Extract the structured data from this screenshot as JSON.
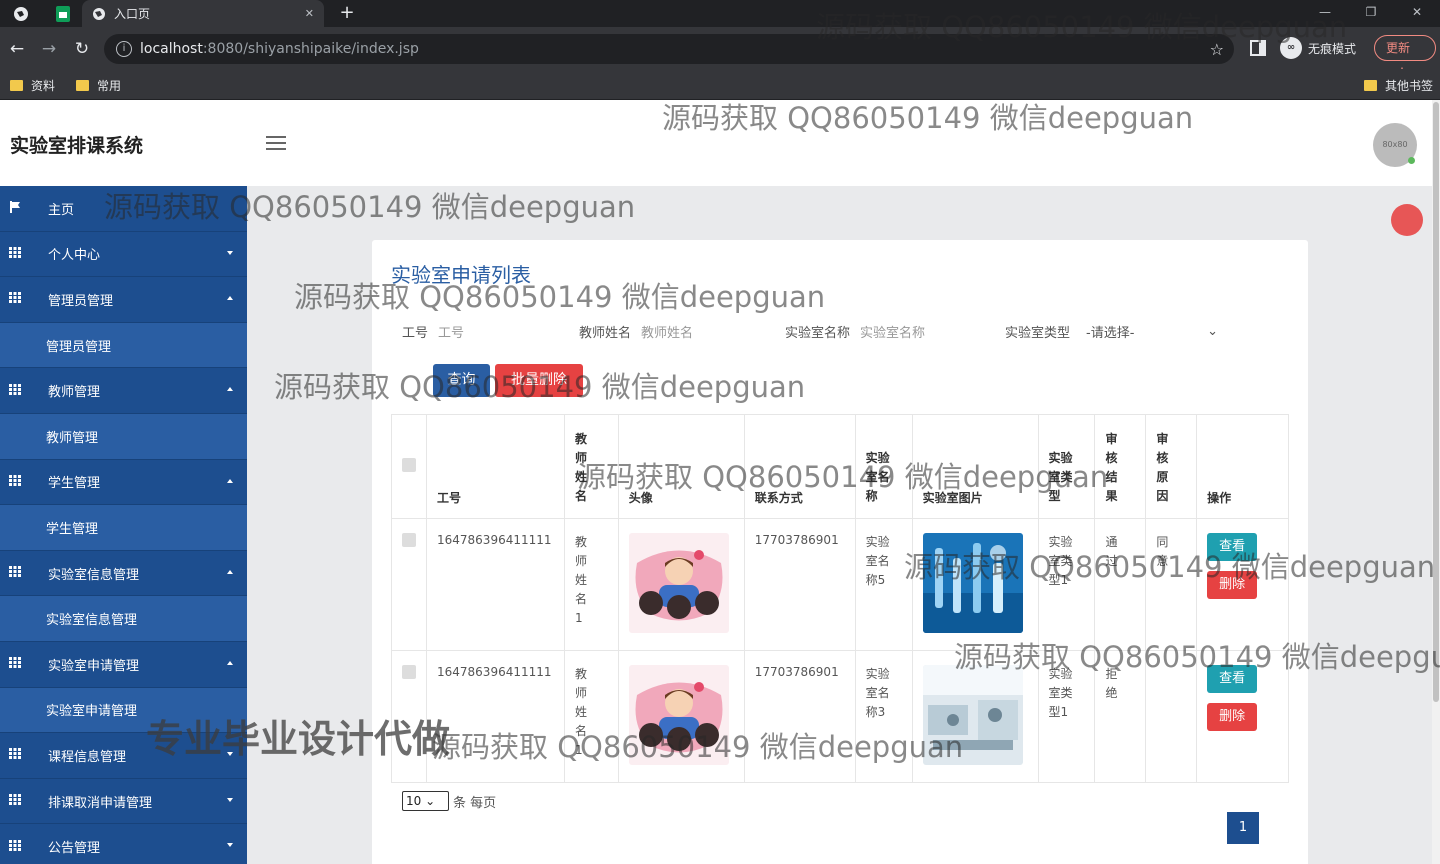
{
  "browser": {
    "tab_title": "入口页",
    "url_host": "localhost",
    "url_path": ":8080/shiyanshipaike/index.jsp",
    "incognito_label": "无痕模式",
    "update_label": "更新",
    "bookmarks": [
      "资料",
      "常用"
    ],
    "other_bookmarks": "其他书签",
    "new_tab_glyph": "+",
    "close_glyph": "✕"
  },
  "header": {
    "brand": "实验室排课系统",
    "avatar_text": "80x80"
  },
  "sidebar": {
    "items": [
      {
        "label": "主页",
        "kind": "top",
        "icon": "flag-icon"
      },
      {
        "label": "个人中心",
        "kind": "top",
        "icon": "grid-icon",
        "caret": "down"
      },
      {
        "label": "管理员管理",
        "kind": "top",
        "icon": "grid-icon",
        "caret": "up"
      },
      {
        "label": "管理员管理",
        "kind": "sub"
      },
      {
        "label": "教师管理",
        "kind": "top",
        "icon": "grid-icon",
        "caret": "up"
      },
      {
        "label": "教师管理",
        "kind": "sub"
      },
      {
        "label": "学生管理",
        "kind": "top",
        "icon": "grid-icon",
        "caret": "up"
      },
      {
        "label": "学生管理",
        "kind": "sub"
      },
      {
        "label": "实验室信息管理",
        "kind": "top",
        "icon": "grid-icon",
        "caret": "up"
      },
      {
        "label": "实验室信息管理",
        "kind": "sub"
      },
      {
        "label": "实验室申请管理",
        "kind": "top",
        "icon": "grid-icon",
        "caret": "up"
      },
      {
        "label": "实验室申请管理",
        "kind": "sub"
      },
      {
        "label": "课程信息管理",
        "kind": "top",
        "icon": "grid-icon",
        "caret": "down"
      },
      {
        "label": "排课取消申请管理",
        "kind": "top",
        "icon": "grid-icon",
        "caret": "down"
      },
      {
        "label": "公告管理",
        "kind": "top",
        "icon": "grid-icon",
        "caret": "down"
      }
    ]
  },
  "page": {
    "title": "实验室申请列表",
    "filters": {
      "gonghao_label": "工号",
      "gonghao_placeholder": "工号",
      "teacher_label": "教师姓名",
      "teacher_placeholder": "教师姓名",
      "lab_name_label": "实验室名称",
      "lab_name_placeholder": "实验室名称",
      "lab_type_label": "实验室类型",
      "lab_type_selected": "-请选择-"
    },
    "buttons": {
      "search": "查询",
      "batch_delete": "批量删除"
    },
    "table": {
      "headers": [
        "工号",
        "教师姓名",
        "头像",
        "联系方式",
        "实验室名称",
        "实验室图片",
        "实验室类型",
        "审核结果",
        "审核原因",
        "操作"
      ],
      "rows": [
        {
          "gonghao": "164786396411111",
          "teacher": "教师姓名1",
          "phone": "17703786901",
          "lab_name": "实验室名称5",
          "lab_type": "实验室类型1",
          "result": "通过",
          "reason": "同意"
        },
        {
          "gonghao": "164786396411111",
          "teacher": "教师姓名1",
          "phone": "17703786901",
          "lab_name": "实验室名称3",
          "lab_type": "实验室类型1",
          "result": "拒绝",
          "reason": ""
        }
      ],
      "view_label": "查看",
      "delete_label": "删除"
    },
    "pagination": {
      "page_size": "10",
      "per_page_text": "条 每页",
      "current_page": "1"
    }
  },
  "watermarks": {
    "text": "源码获取 QQ86050149 微信deepguan",
    "text_cut": "源码获取 QQ86050149 微信deepgu",
    "ad": "专业毕业设计代做"
  },
  "colors": {
    "sidebar": "#1d4e8f",
    "sub_item": "#2a5ea3",
    "primary": "#2a5ea3",
    "danger": "#e64242",
    "view_btn": "#1fa0b0"
  }
}
